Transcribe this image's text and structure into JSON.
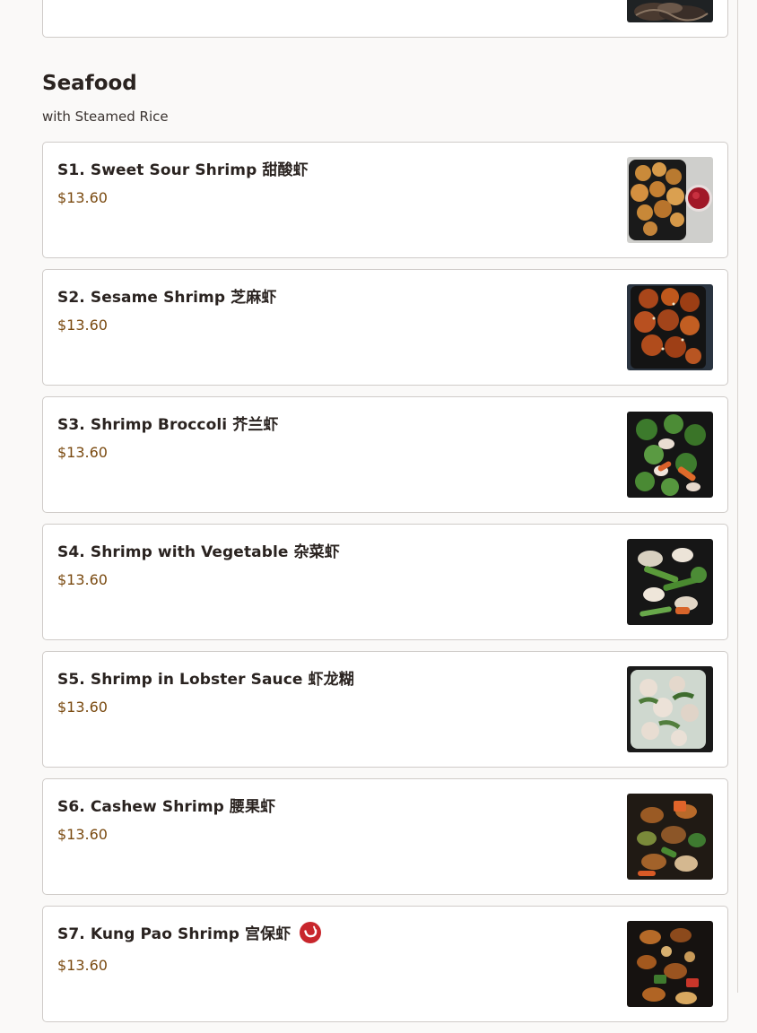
{
  "section": {
    "title": "Seafood",
    "subtitle": "with Steamed Rice"
  },
  "items": [
    {
      "name": "S1. Sweet Sour Shrimp 甜酸虾",
      "price": "$13.60",
      "spicy": false,
      "photo": "sweet-sour-shrimp"
    },
    {
      "name": "S2. Sesame Shrimp 芝麻虾",
      "price": "$13.60",
      "spicy": false,
      "photo": "sesame-shrimp"
    },
    {
      "name": "S3. Shrimp Broccoli 芥兰虾",
      "price": "$13.60",
      "spicy": false,
      "photo": "shrimp-broccoli"
    },
    {
      "name": "S4. Shrimp with Vegetable 杂菜虾",
      "price": "$13.60",
      "spicy": false,
      "photo": "shrimp-vegetable"
    },
    {
      "name": "S5. Shrimp in Lobster Sauce 虾龙糊",
      "price": "$13.60",
      "spicy": false,
      "photo": "shrimp-lobster-sauce"
    },
    {
      "name": "S6. Cashew Shrimp 腰果虾",
      "price": "$13.60",
      "spicy": false,
      "photo": "cashew-shrimp"
    },
    {
      "name": "S7. Kung Pao Shrimp 宫保虾",
      "price": "$13.60",
      "spicy": true,
      "photo": "kung-pao-shrimp"
    }
  ],
  "colors": {
    "price": "#7a4a10",
    "spicy_badge": "#c8262c"
  }
}
